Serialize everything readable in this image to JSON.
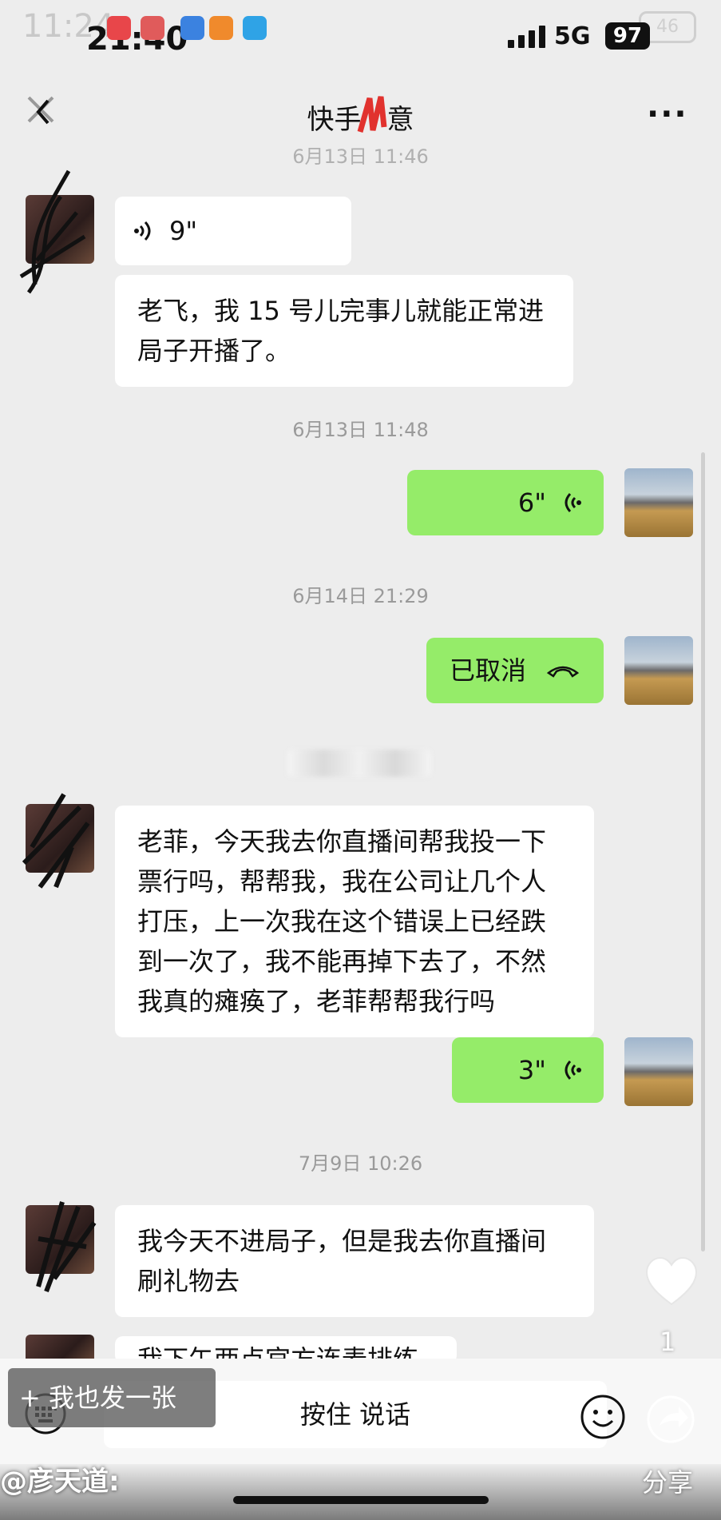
{
  "status_bar": {
    "ghost_time": "11:24",
    "time": "21:40",
    "network": "5G",
    "battery": "97",
    "ghost_battery": "46"
  },
  "header": {
    "title": "快手消息",
    "title_visible": "快手",
    "title_visible_end": "意"
  },
  "messages": [
    {
      "type": "stamp",
      "text": "6月13日 11:46"
    },
    {
      "side": "in",
      "kind": "voice",
      "duration": "9\""
    },
    {
      "side": "in",
      "kind": "text",
      "text": "老飞，我 15 号儿完事儿就能正常进局子开播了。"
    },
    {
      "type": "stamp",
      "text": "6月13日 11:48"
    },
    {
      "side": "out",
      "kind": "voice",
      "duration": "6\""
    },
    {
      "type": "stamp",
      "text": "6月14日 21:29"
    },
    {
      "side": "out",
      "kind": "call",
      "text": "已取消"
    },
    {
      "side": "in",
      "kind": "text",
      "text": "老菲，今天我去你直播间帮我投一下票行吗，帮帮我，我在公司让几个人打压，上一次我在这个错误上已经跌到一次了，我不能再掉下去了，不然我真的瘫痪了，老菲帮帮我行吗"
    },
    {
      "side": "out",
      "kind": "voice",
      "duration": "3\""
    },
    {
      "type": "stamp",
      "text": "7月9日 10:26"
    },
    {
      "side": "in",
      "kind": "text",
      "text": "我今天不进局子，但是我去你直播间刷礼物去"
    },
    {
      "side": "in",
      "kind": "text",
      "text": "我下午两点官方连麦排练"
    }
  ],
  "msg_text": {
    "m1": "老飞，我 15 号儿完事儿就能正常进",
    "m1b": "局子开播了。",
    "m2a": "老菲，今天我去你直播间帮我投一下",
    "m2b": "票行吗，帮帮我，我在公司让几个人",
    "m2c": "打压，上一次我在这个错误上已经跌",
    "m2d": "到一次了，我不能再掉下去了，不然",
    "m2e": "我真的瘫痪了，老菲帮帮我行吗",
    "m3a": "我今天不进局子，但是我去你直播间",
    "m3b": "刷礼物去",
    "m4": "我下午两点官方连麦排练"
  },
  "input_bar": {
    "hold_to_talk": "按住 说话"
  },
  "overlay": {
    "post_button": "+ 我也发一张",
    "author": "@彦天道:",
    "like_count": "1",
    "share_label": "分享"
  },
  "colors": {
    "outgoing_bubble": "#95ec69",
    "incoming_bubble": "#ffffff",
    "background": "#ededed"
  },
  "icons": [
    "back-icon",
    "more-icon",
    "voice-wave-icon",
    "hang-up-icon",
    "heart-icon",
    "keyboard-icon",
    "emoji-icon",
    "share-icon"
  ]
}
